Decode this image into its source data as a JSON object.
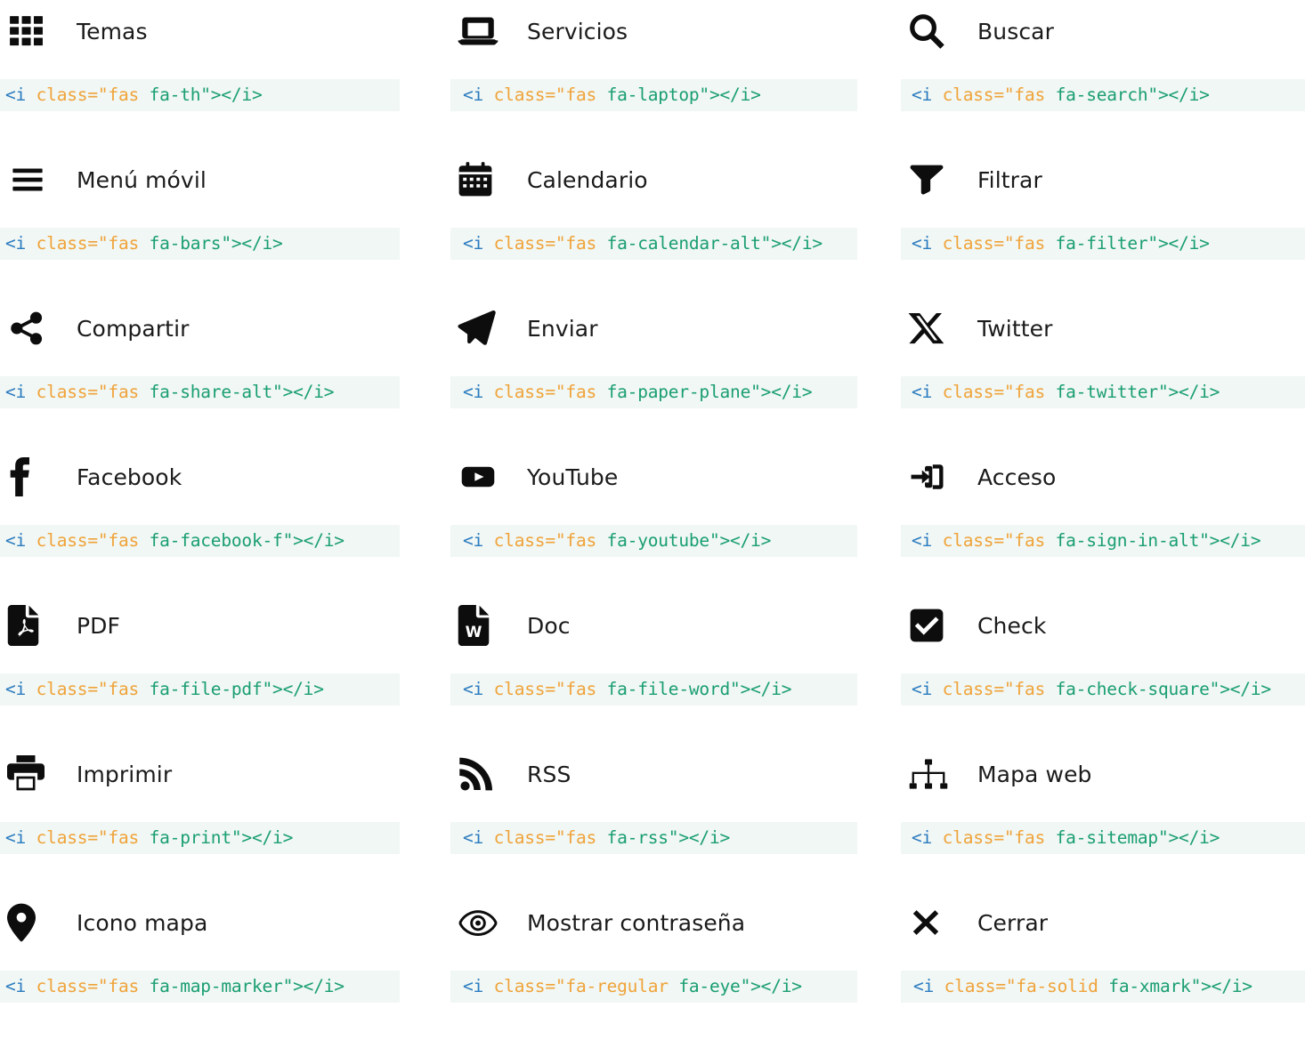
{
  "page": {
    "background": "#ffffff",
    "code_background": "#f0f7f4",
    "syntax_colors": {
      "tag": "#2b7bc0",
      "attribute": "#f0a33a",
      "value": "#1a9e72"
    },
    "columns": 3,
    "rows": 7
  },
  "items": [
    {
      "icon": "th-icon",
      "label": "Temas",
      "code": {
        "tag": "<i ",
        "attr": "class=\"fas",
        "val": " fa-th\"></i>"
      }
    },
    {
      "icon": "laptop-icon",
      "label": "Servicios",
      "code": {
        "tag": "<i ",
        "attr": "class=\"fas",
        "val": " fa-laptop\"></i>"
      }
    },
    {
      "icon": "search-icon",
      "label": "Buscar",
      "code": {
        "tag": "<i ",
        "attr": "class=\"fas",
        "val": " fa-search\"></i>"
      }
    },
    {
      "icon": "bars-icon",
      "label": "Menú móvil",
      "code": {
        "tag": "<i ",
        "attr": "class=\"fas",
        "val": " fa-bars\"></i>"
      }
    },
    {
      "icon": "calendar-alt-icon",
      "label": "Calendario",
      "code": {
        "tag": "<i ",
        "attr": "class=\"fas",
        "val": " fa-calendar-alt\"></i>"
      }
    },
    {
      "icon": "filter-icon",
      "label": "Filtrar",
      "code": {
        "tag": "<i ",
        "attr": "class=\"fas",
        "val": " fa-filter\"></i>"
      }
    },
    {
      "icon": "share-alt-icon",
      "label": "Compartir",
      "code": {
        "tag": "<i ",
        "attr": "class=\"fas",
        "val": " fa-share-alt\"></i>"
      }
    },
    {
      "icon": "paper-plane-icon",
      "label": "Enviar",
      "code": {
        "tag": "<i ",
        "attr": "class=\"fas",
        "val": " fa-paper-plane\"></i>"
      }
    },
    {
      "icon": "twitter-x-icon",
      "label": "Twitter",
      "code": {
        "tag": "<i ",
        "attr": "class=\"fas",
        "val": " fa-twitter\"></i>"
      }
    },
    {
      "icon": "facebook-f-icon",
      "label": "Facebook",
      "code": {
        "tag": "<i ",
        "attr": "class=\"fas",
        "val": " fa-facebook-f\"></i>"
      }
    },
    {
      "icon": "youtube-icon",
      "label": "YouTube",
      "code": {
        "tag": "<i ",
        "attr": "class=\"fas",
        "val": " fa-youtube\"></i>"
      }
    },
    {
      "icon": "sign-in-alt-icon",
      "label": "Acceso",
      "code": {
        "tag": "<i ",
        "attr": "class=\"fas",
        "val": " fa-sign-in-alt\"></i>"
      }
    },
    {
      "icon": "file-pdf-icon",
      "label": "PDF",
      "code": {
        "tag": "<i ",
        "attr": "class=\"fas",
        "val": " fa-file-pdf\"></i>"
      }
    },
    {
      "icon": "file-word-icon",
      "label": "Doc",
      "code": {
        "tag": "<i ",
        "attr": "class=\"fas",
        "val": " fa-file-word\"></i>"
      }
    },
    {
      "icon": "check-square-icon",
      "label": "Check",
      "code": {
        "tag": "<i ",
        "attr": "class=\"fas",
        "val": " fa-check-square\"></i>"
      }
    },
    {
      "icon": "print-icon",
      "label": "Imprimir",
      "code": {
        "tag": "<i ",
        "attr": "class=\"fas",
        "val": " fa-print\"></i>"
      }
    },
    {
      "icon": "rss-icon",
      "label": "RSS",
      "code": {
        "tag": "<i ",
        "attr": "class=\"fas",
        "val": " fa-rss\"></i>"
      }
    },
    {
      "icon": "sitemap-icon",
      "label": "Mapa web",
      "code": {
        "tag": "<i ",
        "attr": "class=\"fas",
        "val": " fa-sitemap\"></i>"
      }
    },
    {
      "icon": "map-marker-icon",
      "label": "Icono mapa",
      "code": {
        "tag": "<i ",
        "attr": "class=\"fas",
        "val": " fa-map-marker\"></i>"
      }
    },
    {
      "icon": "eye-icon",
      "label": "Mostrar contraseña",
      "code": {
        "tag": "<i ",
        "attr": "class=\"fa-regular",
        "val": " fa-eye\"></i>"
      }
    },
    {
      "icon": "xmark-icon",
      "label": "Cerrar",
      "code": {
        "tag": "<i ",
        "attr": "class=\"fa-solid",
        "val": " fa-xmark\"></i>"
      }
    }
  ]
}
